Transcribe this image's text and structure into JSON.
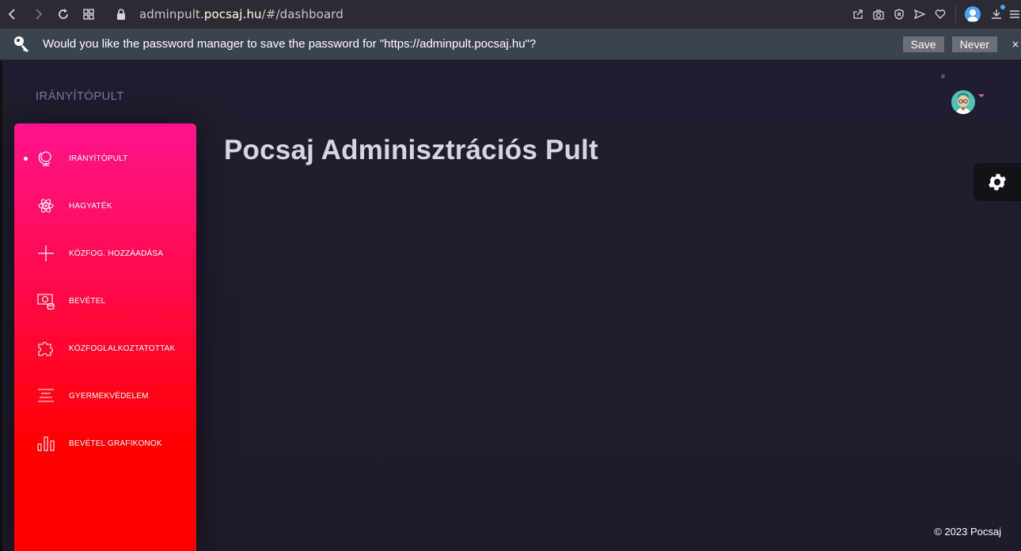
{
  "browser": {
    "url_host_prefix": "adminpult.",
    "url_host": "pocsaj.hu",
    "url_path": "/#/dashboard"
  },
  "infobar": {
    "message": "Would you like the password manager to save the password for \"https://adminpult.pocsaj.hu\"?",
    "save_label": "Save",
    "never_label": "Never",
    "close_label": "×"
  },
  "app": {
    "title": "IRÁNYÍTÓPULT",
    "page_title": "Pocsaj Adminisztrációs Pult",
    "footer": "© 2023 Pocsaj",
    "accent_top": "#ff148c",
    "accent_bottom": "#ff0000"
  },
  "sidebar": {
    "items": [
      {
        "label": "IRÁNYÍTÓPULT",
        "icon": "globe-icon",
        "active": true
      },
      {
        "label": "HAGYATÉK",
        "icon": "atom-icon",
        "active": false
      },
      {
        "label": "KÖZFOG. HOZZÁADÁSA",
        "icon": "plus-icon",
        "active": false
      },
      {
        "label": "BEVÉTEL",
        "icon": "money-icon",
        "active": false
      },
      {
        "label": "KÖZFOGLALKOZTATOTTAK",
        "icon": "puzzle-icon",
        "active": false
      },
      {
        "label": "GYERMEKVÉDELEM",
        "icon": "align-center-icon",
        "active": false
      },
      {
        "label": "BEVÉTEL GRAFIKONOK",
        "icon": "bar-chart-icon",
        "active": false
      }
    ]
  }
}
